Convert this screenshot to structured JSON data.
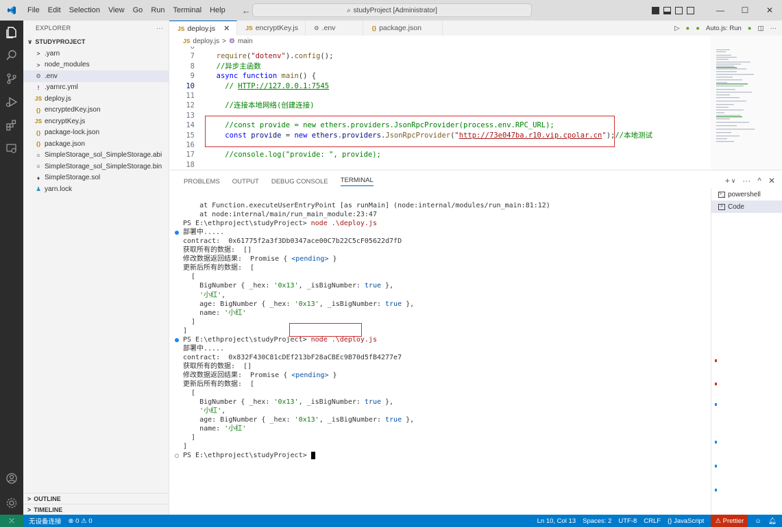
{
  "title_bar": {
    "menu": [
      "File",
      "Edit",
      "Selection",
      "View",
      "Go",
      "Run",
      "Terminal",
      "Help"
    ],
    "command_center": "studyProject [Administrator]"
  },
  "sidebar": {
    "title": "EXPLORER",
    "project": "STUDYPROJECT",
    "items": [
      {
        "label": ".yarn",
        "icon": ">",
        "color": "#555"
      },
      {
        "label": "node_modules",
        "icon": ">",
        "color": "#555"
      },
      {
        "label": ".env",
        "icon": "⚙",
        "color": "#616161"
      },
      {
        "label": ".yarnrc.yml",
        "icon": "!",
        "color": "#7d3c98"
      },
      {
        "label": "deploy.js",
        "icon": "JS",
        "color": "#b8860b"
      },
      {
        "label": "encryptedKey.json",
        "icon": "{}",
        "color": "#b8860b"
      },
      {
        "label": "encryptKey.js",
        "icon": "JS",
        "color": "#b8860b"
      },
      {
        "label": "package-lock.json",
        "icon": "{}",
        "color": "#b8860b"
      },
      {
        "label": "package.json",
        "icon": "{}",
        "color": "#b8860b"
      },
      {
        "label": "SimpleStorage_sol_SimpleStorage.abi",
        "icon": "≡",
        "color": "#888"
      },
      {
        "label": "SimpleStorage_sol_SimpleStorage.bin",
        "icon": "≡",
        "color": "#888"
      },
      {
        "label": "SimpleStorage.sol",
        "icon": "♦",
        "color": "#444"
      },
      {
        "label": "yarn.lock",
        "icon": "♟",
        "color": "#2c8ebb"
      }
    ],
    "outline": "OUTLINE",
    "timeline": "TIMELINE"
  },
  "tabs": [
    {
      "label": "deploy.js",
      "icon": "JS"
    },
    {
      "label": "encryptKey.js",
      "icon": "JS"
    },
    {
      "label": ".env",
      "icon": "⚙"
    },
    {
      "label": "package.json",
      "icon": "{}"
    }
  ],
  "editor_actions": {
    "autojs": "Auto.js: Run"
  },
  "breadcrumb": {
    "file": "deploy.js",
    "sep": ">",
    "symbol": "main"
  },
  "code_lines": [
    {
      "n": "6",
      "html": ""
    },
    {
      "n": "7",
      "html": "  <span class='f'>require</span>(<span class='s'>\"dotenv\"</span>).<span class='f'>config</span>();"
    },
    {
      "n": "8",
      "html": "  <span class='c'>//异步主函数</span>"
    },
    {
      "n": "9",
      "html": "  <span class='k'>async</span> <span class='k'>function</span> <span class='f'>main</span>() {"
    },
    {
      "n": "10",
      "html": "    <span class='c'>// <u>HTTP://127.0.0.1:7545</u></span>"
    },
    {
      "n": "11",
      "html": ""
    },
    {
      "n": "12",
      "html": "    <span class='c'>//连接本地网络(创建连接)</span>"
    },
    {
      "n": "13",
      "html": ""
    },
    {
      "n": "14",
      "html": "    <span class='c'>//const provide = new ethers.providers.JsonRpcProvider(process.env.RPC_URL);</span>"
    },
    {
      "n": "15",
      "html": "    <span class='k'>const</span> <span class='v'>provide</span> = <span class='k'>new</span> <span class='v'>ethers</span>.<span class='v'>providers</span>.<span class='f'>JsonRpcProvider</span>(<span class='s'>\"<u>http://73e047ba.r10.vip.cpolar.cn</u>\"</span>);<span class='c'>//本地测试</span>"
    },
    {
      "n": "16",
      "html": ""
    },
    {
      "n": "17",
      "html": "    <span class='c'>//console.log(\"provide: \", provide);</span>"
    },
    {
      "n": "18",
      "html": ""
    }
  ],
  "panel_tabs": [
    "PROBLEMS",
    "OUTPUT",
    "DEBUG CONSOLE",
    "TERMINAL"
  ],
  "terminals": [
    "powershell",
    "Code"
  ],
  "terminal_lines": [
    {
      "html": ""
    },
    {
      "html": "    at Function.executeUserEntryPoint [as runMain] (node:internal/modules/run_main:81:12)"
    },
    {
      "html": "    at node:internal/main/run_main_module:23:47"
    },
    {
      "html": "PS E:\\ethproject\\studyProject> <span class='tst'>node .\\deploy.js</span>"
    },
    {
      "html": "部署中.....",
      "dot": "blue"
    },
    {
      "html": "contract:  0x61775f2a3f3Db0347ace00C7b22C5cF05622d7fD"
    },
    {
      "html": "获取所有的数据:  []"
    },
    {
      "html": "修改数据返回结果:  Promise { <span class='tcy'>&lt;pending&gt;</span> }"
    },
    {
      "html": "更新后所有的数据:  ["
    },
    {
      "html": "  ["
    },
    {
      "html": "    BigNumber { _hex: <span class='tgreen'>'0x13'</span>, _isBigNumber: <span class='tcy'>true</span> },"
    },
    {
      "html": "    <span class='tgreen'>'小红'</span>,"
    },
    {
      "html": "    age: BigNumber { _hex: <span class='tgreen'>'0x13'</span>, _isBigNumber: <span class='tcy'>true</span> },"
    },
    {
      "html": "    name: <span class='tgreen'>'小红'</span>"
    },
    {
      "html": "  ]"
    },
    {
      "html": "]"
    },
    {
      "html": "PS E:\\ethproject\\studyProject> <span class='tst'>node .\\deploy.js</span>",
      "dot": "blue"
    },
    {
      "html": "部署中....."
    },
    {
      "html": "contract:  0x832F430C81cDEf213bF28aCBEc9B70d5fB4277e7"
    },
    {
      "html": "获取所有的数据:  []"
    },
    {
      "html": "修改数据返回结果:  Promise { <span class='tcy'>&lt;pending&gt;</span> }"
    },
    {
      "html": "更新后所有的数据:  ["
    },
    {
      "html": "  ["
    },
    {
      "html": "    BigNumber { _hex: <span class='tgreen'>'0x13'</span>, _isBigNumber: <span class='tcy'>true</span> },"
    },
    {
      "html": "    <span class='tgreen'>'小红'</span>,"
    },
    {
      "html": "    age: BigNumber { _hex: <span class='tgreen'>'0x13'</span>, _isBigNumber: <span class='tcy'>true</span> },"
    },
    {
      "html": "    name: <span class='tgreen'>'小红'</span>"
    },
    {
      "html": "  ]"
    },
    {
      "html": "]"
    },
    {
      "html": "PS E:\\ethproject\\studyProject> <span style='background:#000;color:#000'>_</span>",
      "dot": "hollow"
    }
  ],
  "status": {
    "remote_icon": "⤫",
    "connection": "无设备连接",
    "problems": "⊗ 0 ⚠ 0",
    "position": "Ln 10, Col 13",
    "spaces": "Spaces: 2",
    "encoding": "UTF-8",
    "eol": "CRLF",
    "language": "{} JavaScript",
    "prettier": "⚠ Prettier"
  },
  "colors": {
    "accent": "#007acc",
    "remote": "#16825d",
    "prettier": "#c72e0f",
    "highlight_box": "#d32f2f"
  }
}
